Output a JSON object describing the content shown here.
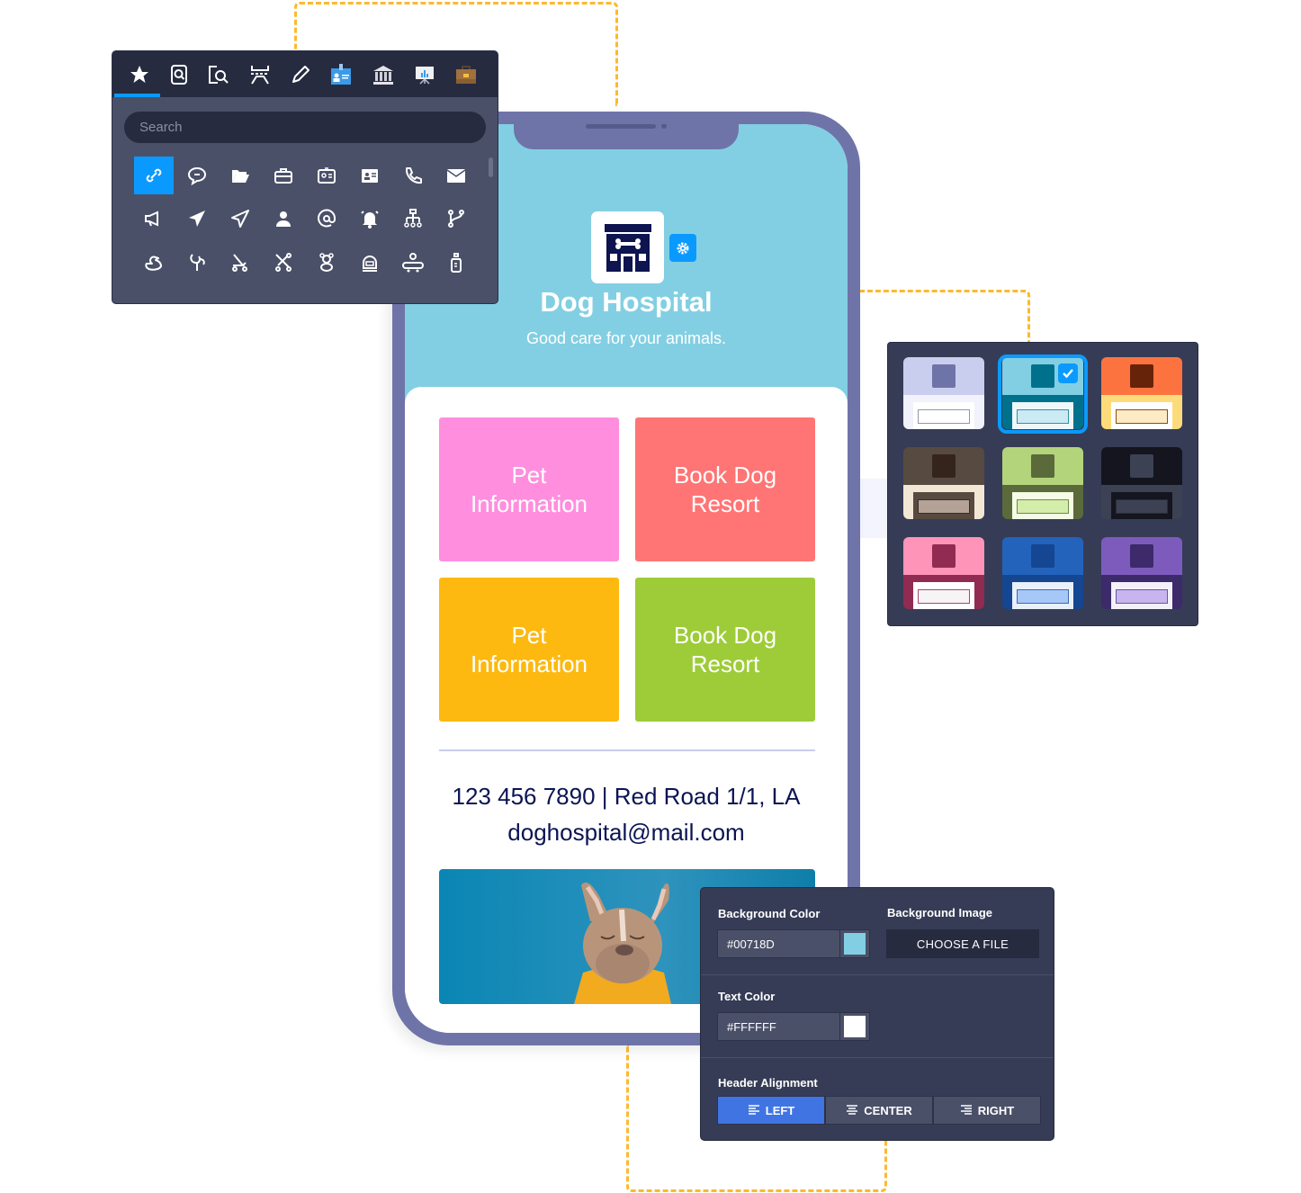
{
  "app": {
    "title": "Dog Hospital",
    "subtitle": "Good care for your animals."
  },
  "icon_picker": {
    "tabs": [
      {
        "icon": "star-icon",
        "active": true
      },
      {
        "icon": "document-search-icon",
        "active": false
      },
      {
        "icon": "file-search-icon",
        "active": false
      },
      {
        "icon": "table-row-icon",
        "active": false
      },
      {
        "icon": "pencil-icon",
        "active": false
      },
      {
        "icon": "id-badge-icon",
        "active": false
      },
      {
        "icon": "bank-icon",
        "active": false
      },
      {
        "icon": "presentation-chart-icon",
        "active": false
      },
      {
        "icon": "briefcase-icon",
        "active": false
      }
    ],
    "search_placeholder": "Search",
    "icons": [
      [
        "link-icon",
        "chat-bubble-icon",
        "folder-open-icon",
        "briefcase-outline-icon",
        "id-card-icon",
        "contact-card-icon",
        "phone-icon",
        "envelope-icon"
      ],
      [
        "megaphone-icon",
        "paper-plane-filled-icon",
        "paper-plane-outline-icon",
        "user-icon",
        "at-sign-icon",
        "bell-ringing-icon",
        "org-chart-icon",
        "git-branch-icon"
      ],
      [
        "rubber-duck-icon",
        "baby-rattle-icon",
        "stroller-icon",
        "stroller-folded-icon",
        "teddy-bear-icon",
        "baby-scale-icon",
        "baby-crib-icon",
        "baby-bottle-icon"
      ]
    ],
    "selected_icon": "link-icon"
  },
  "tiles": [
    {
      "label": "Pet\nInformation",
      "color": "#FF8EDE"
    },
    {
      "label": "Book Dog\nResort",
      "color": "#FF7474"
    },
    {
      "label": "Pet\nInformation",
      "color": "#FDB910"
    },
    {
      "label": "Book Dog\nResort",
      "color": "#9DCC38"
    }
  ],
  "contact": {
    "line1": "123 456 7890 | Red Road 1/1, LA",
    "line2": "doghospital@mail.com"
  },
  "themes": [
    {
      "name": "lavender",
      "top": "#C9CEEE",
      "bottom": "#F1F2FB",
      "square": "#6F74A8",
      "card": "#FFFFFF",
      "field": "#FFFFFF",
      "field_border": "#9098A8",
      "selected": false
    },
    {
      "name": "sky",
      "top": "#82CFE3",
      "bottom": "#00718D",
      "square": "#00718D",
      "card": "#EEF7FA",
      "field": "#CBEAF3",
      "field_border": "#2F8FAA",
      "selected": true
    },
    {
      "name": "orange",
      "top": "#FD7340",
      "bottom": "#FEDB7A",
      "square": "#67220A",
      "card": "#FFFFFF",
      "field": "#FDEBC6",
      "field_border": "#8A4A1A",
      "selected": false
    },
    {
      "name": "brown",
      "top": "#574A40",
      "bottom": "#F1E7D4",
      "square": "#35241B",
      "card": "#574A40",
      "field": "#B4A296",
      "field_border": "#3A2E26",
      "selected": false
    },
    {
      "name": "olive",
      "top": "#B3D47B",
      "bottom": "#5A6A3A",
      "square": "#5A6A3A",
      "card": "#F5FBE5",
      "field": "#D4EDAA",
      "field_border": "#6E8A4A",
      "selected": false
    },
    {
      "name": "dark",
      "top": "#14151E",
      "bottom": "#3C4254",
      "square": "#3C4254",
      "card": "#14151E",
      "field": "#3C4254",
      "field_border": "#2A2E3A",
      "selected": false
    },
    {
      "name": "pink",
      "top": "#FF94B9",
      "bottom": "#922B52",
      "square": "#922B52",
      "card": "#FFFFFF",
      "field": "#F7F4F6",
      "field_border": "#A64A6E",
      "selected": false
    },
    {
      "name": "blue",
      "top": "#2463BC",
      "bottom": "#144692",
      "square": "#144692",
      "card": "#E8F0FA",
      "field": "#A6C7F7",
      "field_border": "#3E6AB0",
      "selected": false
    },
    {
      "name": "purple",
      "top": "#7D5BBC",
      "bottom": "#3C2A6A",
      "square": "#3C2A6A",
      "card": "#F3F0FA",
      "field": "#C8B4EE",
      "field_border": "#6A55A0",
      "selected": false
    }
  ],
  "properties": {
    "bg_color_label": "Background Color",
    "bg_color_value": "#00718D",
    "bg_color_swatch": "#82CFE3",
    "bg_image_label": "Background Image",
    "choose_file_label": "CHOOSE A FILE",
    "text_color_label": "Text Color",
    "text_color_value": "#FFFFFF",
    "text_color_swatch": "#FFFFFF",
    "header_alignment_label": "Header Alignment",
    "alignment_options": [
      {
        "label": "LEFT",
        "icon": "align-left-icon",
        "active": true
      },
      {
        "label": "CENTER",
        "icon": "align-center-icon",
        "active": false
      },
      {
        "label": "RIGHT",
        "icon": "align-right-icon",
        "active": false
      }
    ]
  }
}
